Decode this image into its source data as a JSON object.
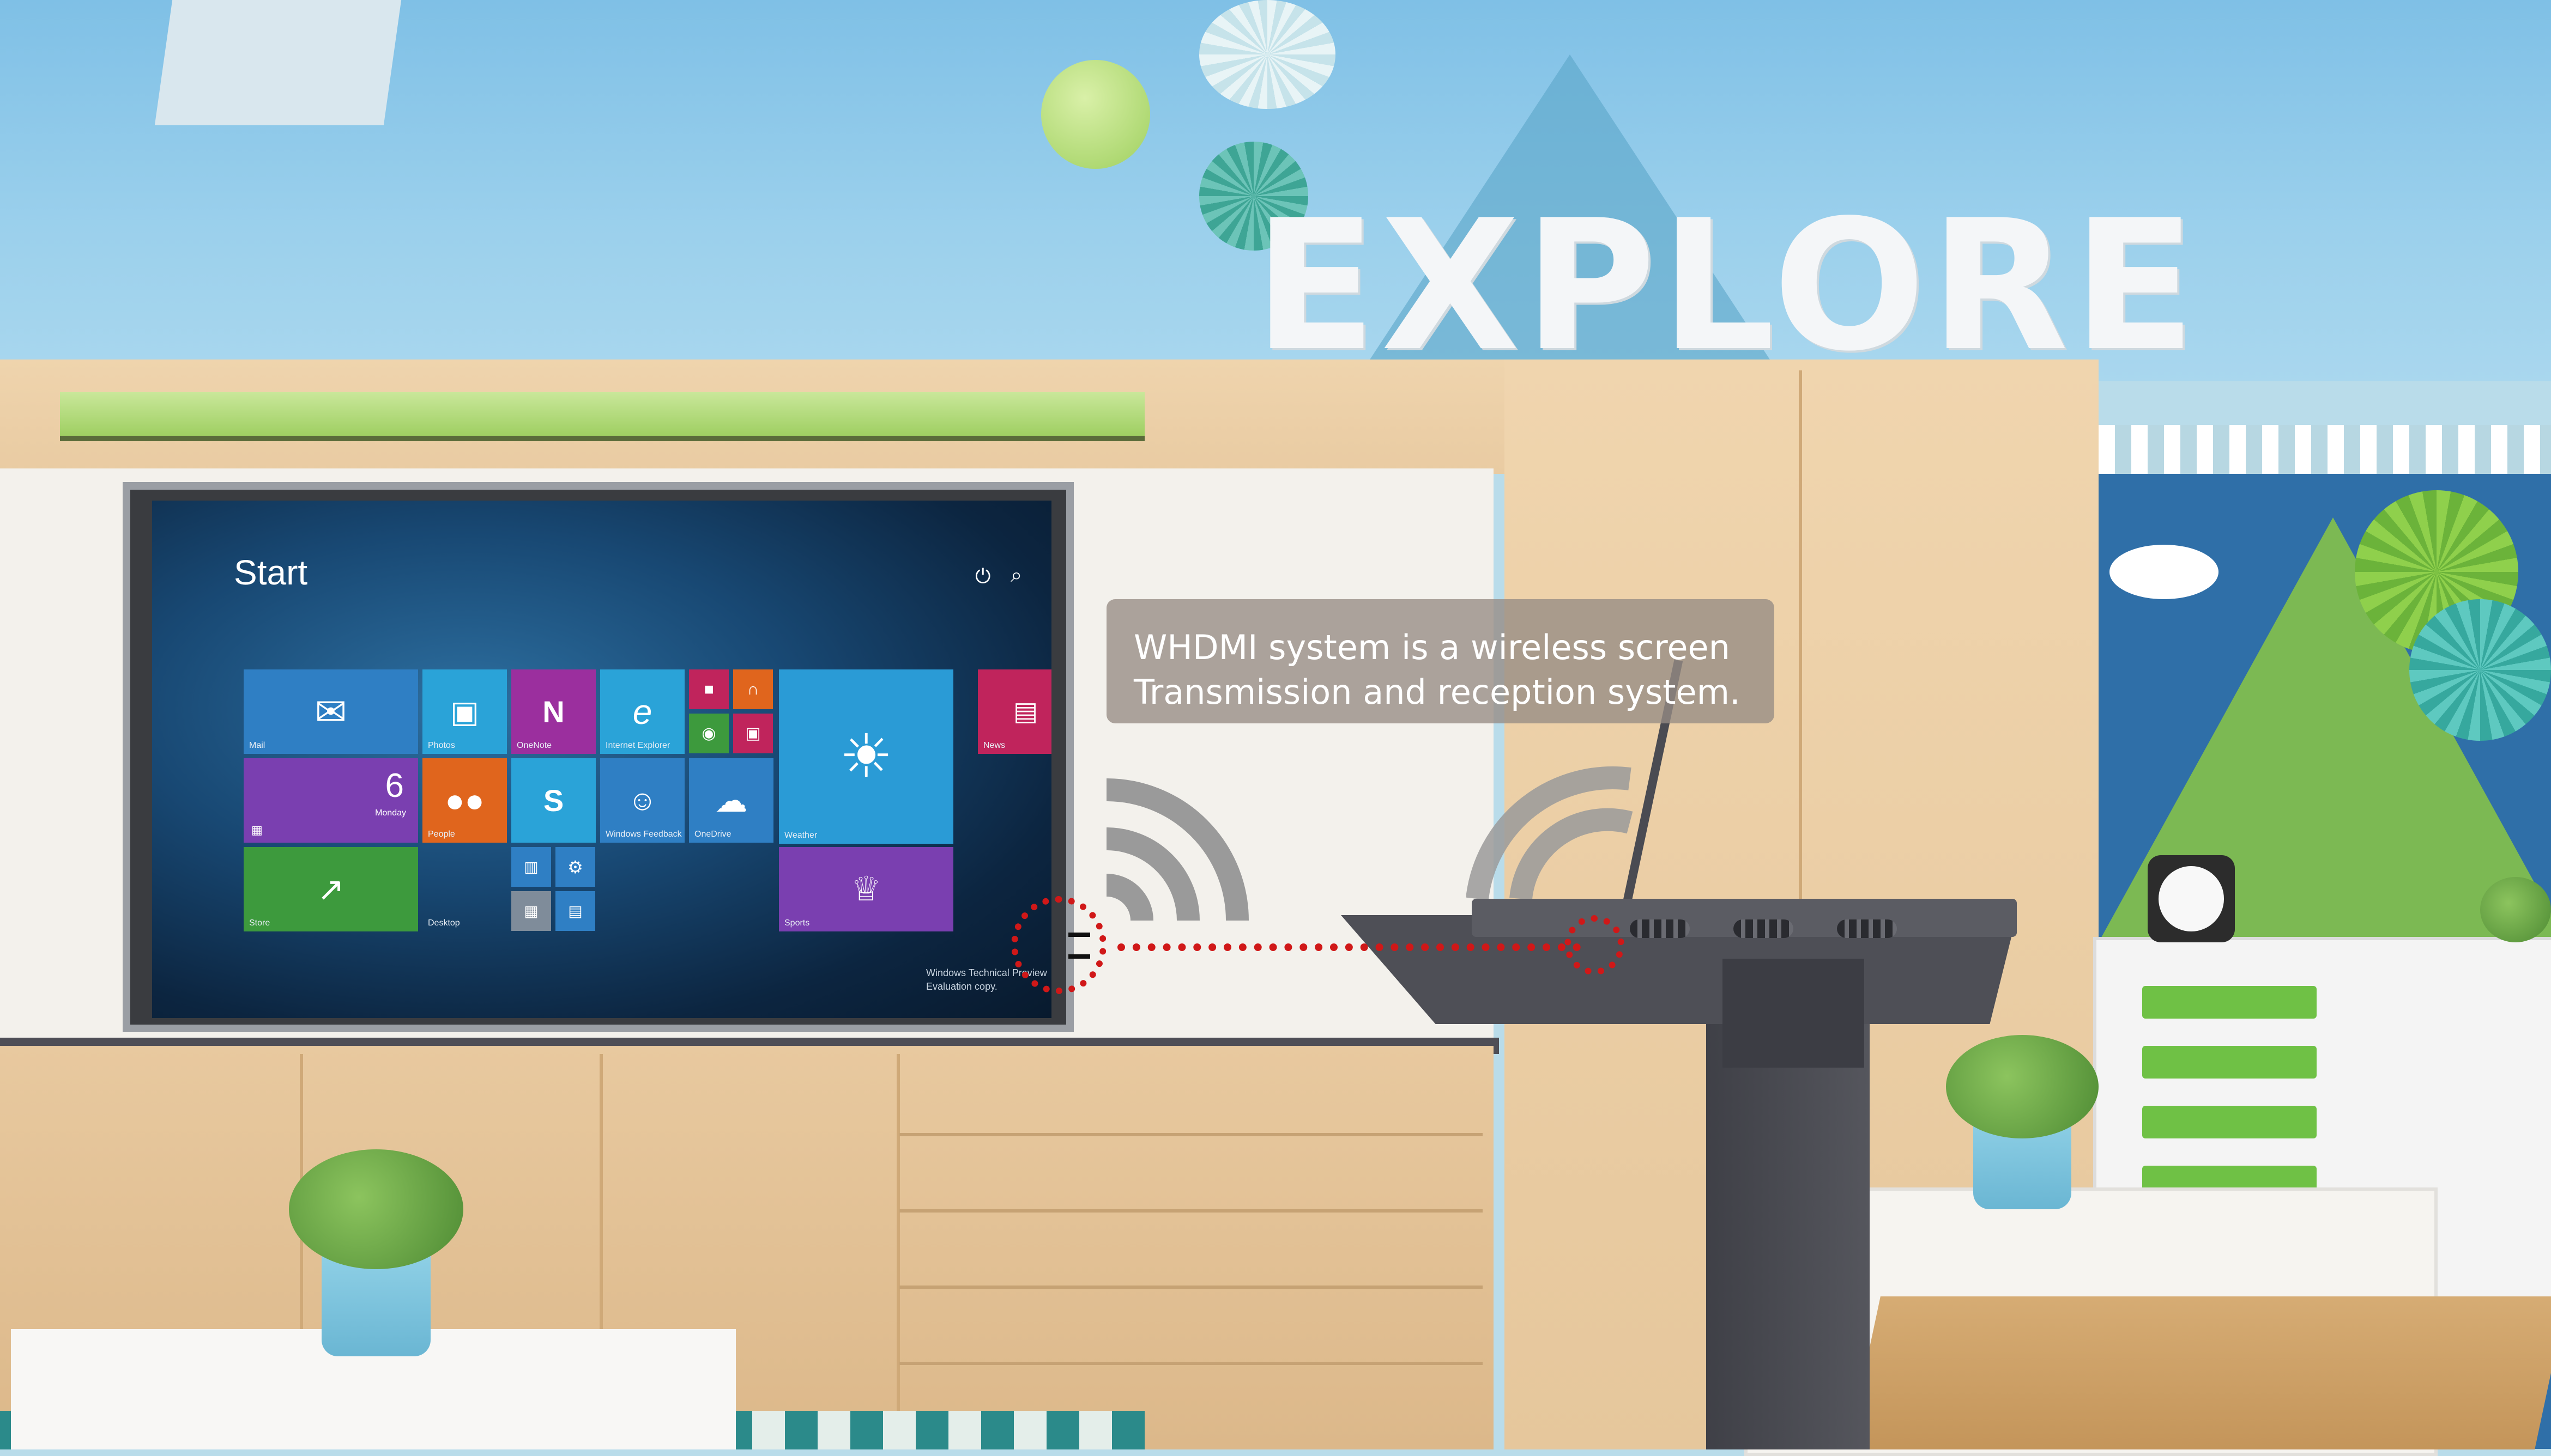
{
  "scene": {
    "wall_sign": "EXPLORE",
    "colors": {
      "link_line": "#d01818",
      "callout_bg": "#968c84",
      "wifi_icon": "#9a9a9a",
      "podium": "#4e4f56"
    }
  },
  "display": {
    "start_label": "Start",
    "power_icon": "power-icon",
    "search_icon": "search-icon",
    "tiles": [
      {
        "label": "Mail",
        "color": "#2f7fc4",
        "icon": "mail-icon"
      },
      {
        "label": "Photos",
        "color": "#2aa3d8",
        "icon": "photos-icon"
      },
      {
        "label": "OneNote",
        "color": "#9b2f9e",
        "icon": "onenote-icon"
      },
      {
        "label": "Internet Explorer",
        "color": "#2aa3d8",
        "icon": "ie-icon"
      },
      {
        "label": "News",
        "color": "#c0245c",
        "icon": "news-icon"
      },
      {
        "label": "Weather",
        "color": "#2a9bd6",
        "icon": "weather-icon"
      },
      {
        "label": "Calendar",
        "color": "#7a3fb0",
        "icon": "calendar-icon",
        "value": "6",
        "sub": "Monday"
      },
      {
        "label": "People",
        "color": "#e0651d",
        "icon": "people-icon"
      },
      {
        "label": "Skype",
        "color": "#2aa3d8",
        "icon": "skype-icon"
      },
      {
        "label": "Windows Feedback",
        "color": "#2f7fc4",
        "icon": "feedback-icon"
      },
      {
        "label": "OneDrive",
        "color": "#2f7fc4",
        "icon": "onedrive-icon"
      },
      {
        "label": "Store",
        "color": "#3d9a3d",
        "icon": "store-icon"
      },
      {
        "label": "Desktop",
        "color": "#1c4a73",
        "icon": "desktop-icon"
      },
      {
        "label": "Sports",
        "color": "#7a3fb0",
        "icon": "trophy-icon"
      }
    ],
    "watermark_line1": "Windows Technical Preview",
    "watermark_line2": "Evaluation copy."
  },
  "callout": {
    "line1": "WHDMI system is a wireless screen",
    "line2": "Transmission and reception system."
  }
}
